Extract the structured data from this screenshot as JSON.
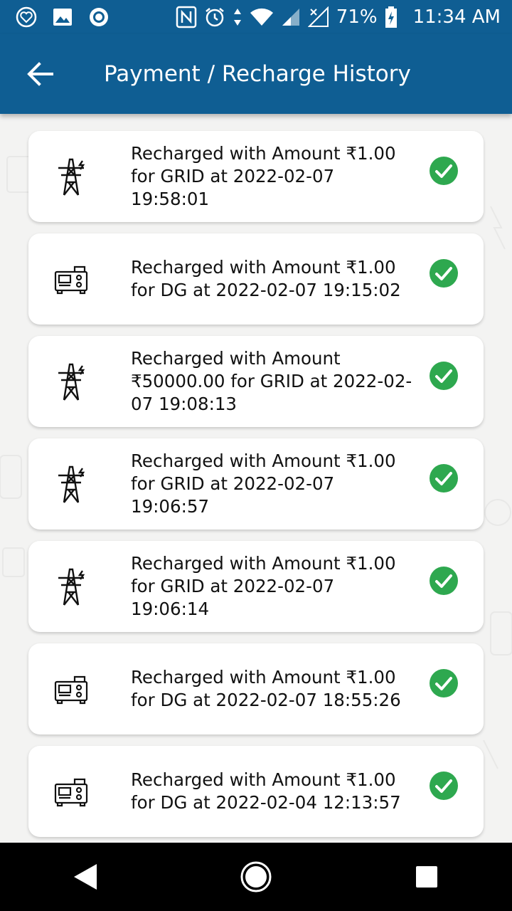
{
  "status_bar": {
    "battery_percent": "71%",
    "time": "11:34 AM",
    "icons_left": [
      "heart-app-icon",
      "image-icon",
      "circle-app-icon"
    ],
    "icons_right": [
      "nfc-icon",
      "alarm-icon",
      "data-arrows-icon",
      "wifi-icon",
      "signal-icon",
      "no-sim-icon",
      "battery-charging-icon"
    ]
  },
  "header": {
    "title": "Payment / Recharge History",
    "back_icon": "back-arrow-icon"
  },
  "colors": {
    "primary": "#0f5e93",
    "success": "#2ea84f",
    "card": "#ffffff",
    "background": "#f3f3f2"
  },
  "history": [
    {
      "type": "GRID",
      "icon": "power-tower-icon",
      "text": "Recharged with Amount ₹1.00 for GRID at 2022-02-07 19:58:01",
      "status": "success"
    },
    {
      "type": "DG",
      "icon": "generator-icon",
      "text": "Recharged with Amount ₹1.00 for DG at 2022-02-07 19:15:02",
      "status": "success"
    },
    {
      "type": "GRID",
      "icon": "power-tower-icon",
      "text": "Recharged with Amount ₹50000.00 for GRID at 2022-02-07 19:08:13",
      "status": "success"
    },
    {
      "type": "GRID",
      "icon": "power-tower-icon",
      "text": "Recharged with Amount ₹1.00 for GRID at 2022-02-07 19:06:57",
      "status": "success"
    },
    {
      "type": "GRID",
      "icon": "power-tower-icon",
      "text": "Recharged with Amount ₹1.00 for GRID at 2022-02-07 19:06:14",
      "status": "success"
    },
    {
      "type": "DG",
      "icon": "generator-icon",
      "text": "Recharged with Amount ₹1.00 for DG at 2022-02-07 18:55:26",
      "status": "success"
    },
    {
      "type": "DG",
      "icon": "generator-icon",
      "text": "Recharged with Amount ₹1.00 for DG at 2022-02-04 12:13:57",
      "status": "success"
    }
  ],
  "nav_bar": {
    "buttons": [
      "back-triangle-icon",
      "home-circle-icon",
      "recents-square-icon"
    ]
  }
}
